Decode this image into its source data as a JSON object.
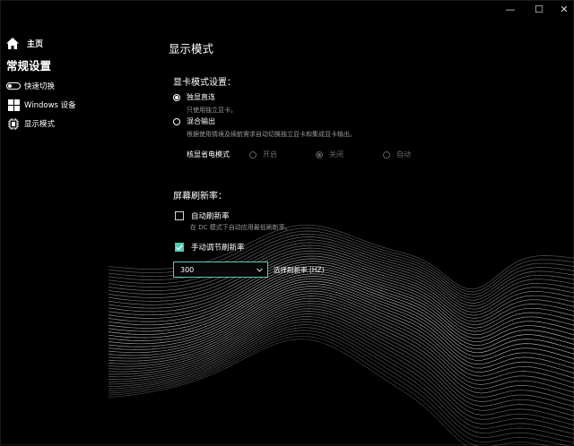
{
  "window": {
    "controls": {
      "minimize": "—",
      "maximize": "☐",
      "close": "✕"
    }
  },
  "sidebar": {
    "home_label": "主页",
    "section_title": "常规设置",
    "items": [
      {
        "label": "快速切换",
        "icon": "toggle-icon"
      },
      {
        "label": "Windows 设备",
        "icon": "windows-logo-icon"
      },
      {
        "label": "显示模式",
        "icon": "display-mode-icon"
      }
    ]
  },
  "main": {
    "title": "显示模式",
    "gpu_mode": {
      "title": "显卡模式设置：",
      "options": [
        {
          "label": "独显直连",
          "desc": "只使用独立显卡。",
          "selected": true
        },
        {
          "label": "混合输出",
          "desc": "根据使用情境及续航需求自动切换独立显卡和集成显卡输出。",
          "selected": false
        }
      ],
      "power_save": {
        "label": "核显省电模式",
        "options": [
          {
            "label": "开启",
            "selected": false
          },
          {
            "label": "关闭",
            "selected": true
          },
          {
            "label": "自动",
            "selected": false
          }
        ]
      }
    },
    "refresh": {
      "title": "屏幕刷新率：",
      "auto": {
        "label": "自动刷新率",
        "desc": "在 DC 模式下自动应用最低刷新率。",
        "checked": false
      },
      "manual": {
        "label": "手动调节刷新率",
        "checked": true
      },
      "select": {
        "value": "300",
        "label": "选择刷新率 (HZ)"
      }
    }
  },
  "colors": {
    "accent": "#57c9b3",
    "background": "#000000"
  }
}
